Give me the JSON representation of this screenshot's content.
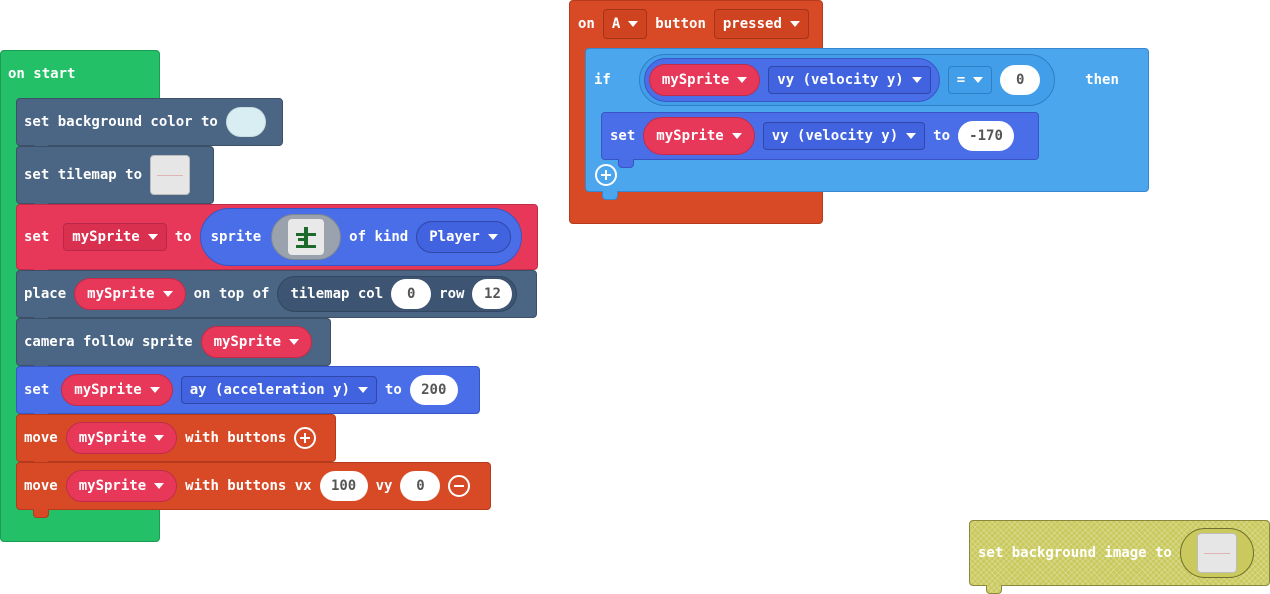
{
  "on_start": {
    "hat": "on start",
    "bg_color": {
      "label": "set background color to",
      "swatch": "#d9eef2"
    },
    "tilemap": {
      "label": "set tilemap to"
    },
    "set_sprite": {
      "set": "set",
      "var": "mySprite",
      "to": "to",
      "sprite": "sprite",
      "of_kind": "of kind",
      "kind": "Player"
    },
    "place": {
      "place": "place",
      "var": "mySprite",
      "on_top_of": "on top of",
      "tilemap_col": "tilemap col",
      "col": "0",
      "row_label": "row",
      "row": "12"
    },
    "camera": {
      "label": "camera follow sprite",
      "var": "mySprite"
    },
    "set_ay": {
      "set": "set",
      "var": "mySprite",
      "prop": "ay (acceleration y)",
      "to": "to",
      "value": "200"
    },
    "move1": {
      "move": "move",
      "var": "mySprite",
      "with": "with buttons"
    },
    "move2": {
      "move": "move",
      "var": "mySprite",
      "with": "with buttons vx",
      "vx": "100",
      "vy_label": "vy",
      "vy": "0"
    }
  },
  "on_button": {
    "on": "on",
    "button": "A",
    "button_label": "button",
    "event": "pressed",
    "if": "if",
    "then": "then",
    "cond": {
      "var": "mySprite",
      "prop": "vy (velocity y)",
      "op": "=",
      "value": "0"
    },
    "set_vy": {
      "set": "set",
      "var": "mySprite",
      "prop": "vy (velocity y)",
      "to": "to",
      "value": "-170"
    }
  },
  "bg_image": {
    "label": "set background image to"
  },
  "colors": {
    "green": "#23c067",
    "slate": "#4b6584",
    "pink": "#e7385a",
    "blue": "#4a6ee8",
    "orange": "#d84a25",
    "light_blue": "#4ba6ee",
    "olive": "#c9c95d"
  }
}
